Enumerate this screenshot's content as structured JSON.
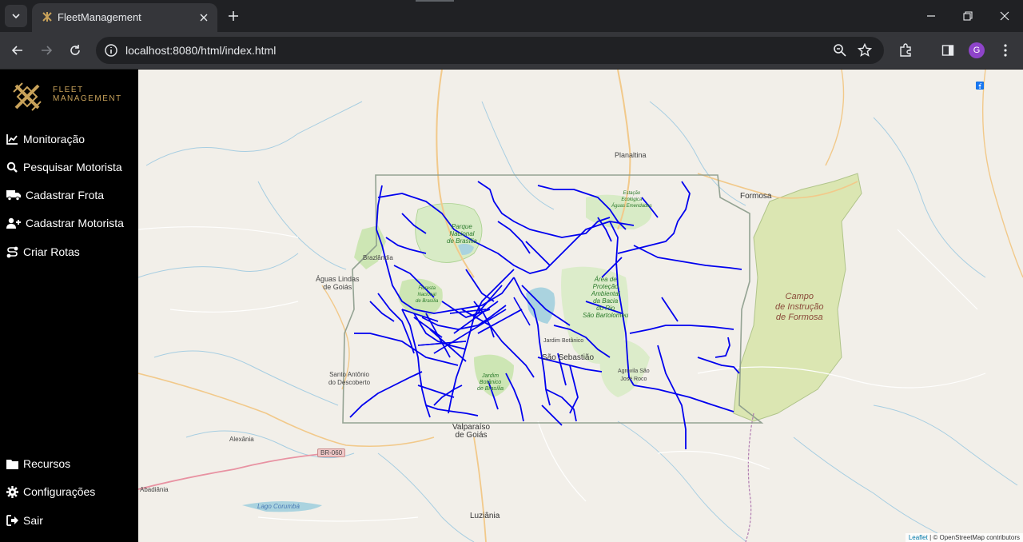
{
  "browser": {
    "tab_title": "FleetManagement",
    "url": "localhost:8080/html/index.html",
    "profile_initial": "G"
  },
  "sidebar": {
    "logo_line1": "FLEET",
    "logo_line2": "MANAGEMENT",
    "items": [
      {
        "label": "Monitoração",
        "icon": "chart-line-icon"
      },
      {
        "label": "Pesquisar Motorista",
        "icon": "search-icon"
      },
      {
        "label": "Cadastrar Frota",
        "icon": "truck-icon"
      },
      {
        "label": "Cadastrar Motorista",
        "icon": "user-plus-icon"
      },
      {
        "label": "Criar Rotas",
        "icon": "route-icon"
      }
    ],
    "bottom_items": [
      {
        "label": "Recursos",
        "icon": "folder-icon"
      },
      {
        "label": "Configurações",
        "icon": "gear-icon"
      },
      {
        "label": "Sair",
        "icon": "sign-out-icon"
      }
    ]
  },
  "map": {
    "places": {
      "planaltina": "Planaltina",
      "formosa": "Formosa",
      "aguas_lindas": "Águas Lindas\nde Goiás",
      "brazlandia": "Brazlândia",
      "santo_antonio": "Santo Antônio\ndo Descoberto",
      "valparaiso": "Valparaíso\nde Goiás",
      "alexania": "Alexânia",
      "abadiania": "Abadiânia",
      "luziania": "Luziânia",
      "sao_sebastiao": "São Sebastião",
      "jardim_botanico": "Jardim Botânico",
      "agrovila": "Agrovila São\nJosé Roco",
      "lago_corumba": "Lago Corumbá"
    },
    "parks": {
      "parque_nacional": "Parque\nNacional\nde Brasília",
      "estacao": "Estação\nEcológica\nÁguas Emendadas",
      "apa": "Área de\nProteção\nAmbiental\nda Bacia\ndo Rio\nSão Bartolomeu",
      "floresta": "Floresta\nNacional\nde Brasília",
      "jardim_botanico_park": "Jardim\nBotânico\nde Brasília"
    },
    "campo": "Campo\nde Instrução\nde Formosa",
    "road_shield": "BR-060",
    "attribution_leaflet": "Leaflet",
    "attribution_rest": " | © OpenStreetMap contributors",
    "social_icons": [
      "linkedin-icon",
      "facebook-icon",
      "instagram-icon"
    ],
    "route_color": "#0000ee"
  },
  "colors": {
    "sidebar_bg": "#000000",
    "accent_gold": "#c8a25a",
    "chrome_dark": "#202124",
    "chrome_mid": "#35363a"
  }
}
